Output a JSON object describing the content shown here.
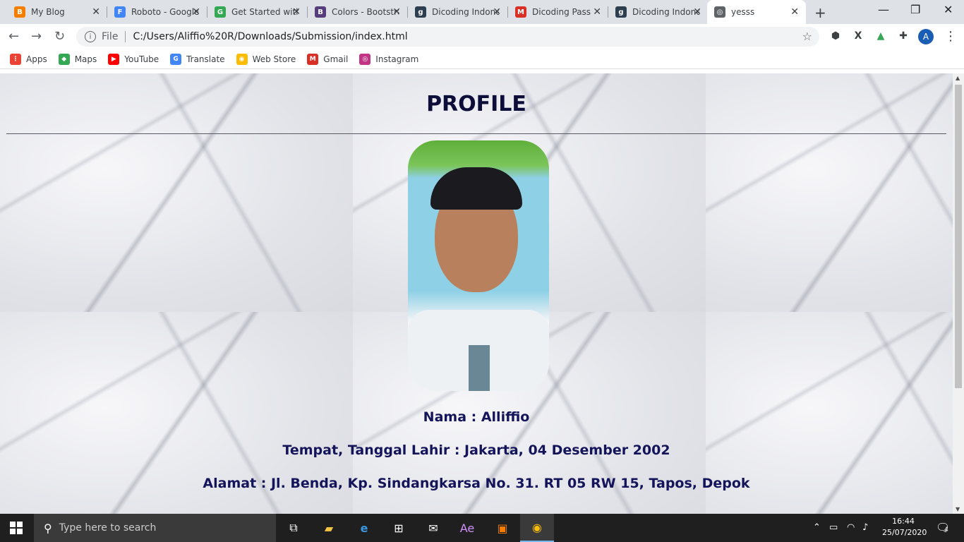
{
  "tabs": [
    {
      "title": "My Blog",
      "favicon": "blogger-icon",
      "color": "#f57d00",
      "glyph": "B"
    },
    {
      "title": "Roboto - Google Fonts",
      "favicon": "google-fonts-icon",
      "color": "#4285f4",
      "glyph": "F"
    },
    {
      "title": "Get Started with Bootstrap",
      "favicon": "getstarted-icon",
      "color": "#34a853",
      "glyph": "G"
    },
    {
      "title": "Colors - Bootstrap",
      "favicon": "bootstrap-icon",
      "color": "#563d7c",
      "glyph": "B"
    },
    {
      "title": "Dicoding Indonesia",
      "favicon": "dicoding-icon",
      "color": "#2d3e50",
      "glyph": "g"
    },
    {
      "title": "Dicoding Pass",
      "favicon": "gmail-icon",
      "color": "#d93025",
      "glyph": "M"
    },
    {
      "title": "Dicoding Indonesia",
      "favicon": "dicoding-icon",
      "color": "#2d3e50",
      "glyph": "g"
    },
    {
      "title": "yesss",
      "favicon": "globe-icon",
      "color": "#5f6368",
      "glyph": "◎"
    }
  ],
  "address": {
    "scheme_label": "File",
    "url": "C:/Users/Aliffio%20R/Downloads/Submission/index.html"
  },
  "bookmarks": [
    {
      "label": "Apps",
      "icon": "apps-grid-icon",
      "color": "#ea4335"
    },
    {
      "label": "Maps",
      "icon": "maps-icon",
      "color": "#34a853"
    },
    {
      "label": "YouTube",
      "icon": "youtube-icon",
      "color": "#ff0000"
    },
    {
      "label": "Translate",
      "icon": "translate-icon",
      "color": "#4285f4"
    },
    {
      "label": "Web Store",
      "icon": "webstore-icon",
      "color": "#fbbc04"
    },
    {
      "label": "Gmail",
      "icon": "gmail-icon",
      "color": "#d93025"
    },
    {
      "label": "Instagram",
      "icon": "instagram-icon",
      "color": "#c13584"
    }
  ],
  "profile": {
    "heading": "PROFILE",
    "nama": "Nama : Alliffio",
    "ttl": "Tempat, Tanggal Lahir : Jakarta, 04 Desember 2002",
    "alamat": "Alamat : Jl. Benda, Kp. Sindangkarsa No. 31. RT 05 RW 15, Tapos, Depok"
  },
  "profile_user_initial": "A",
  "taskbar": {
    "search_placeholder": "Type here to search",
    "time": "16:44",
    "date": "25/07/2020",
    "notification_count": "4"
  }
}
